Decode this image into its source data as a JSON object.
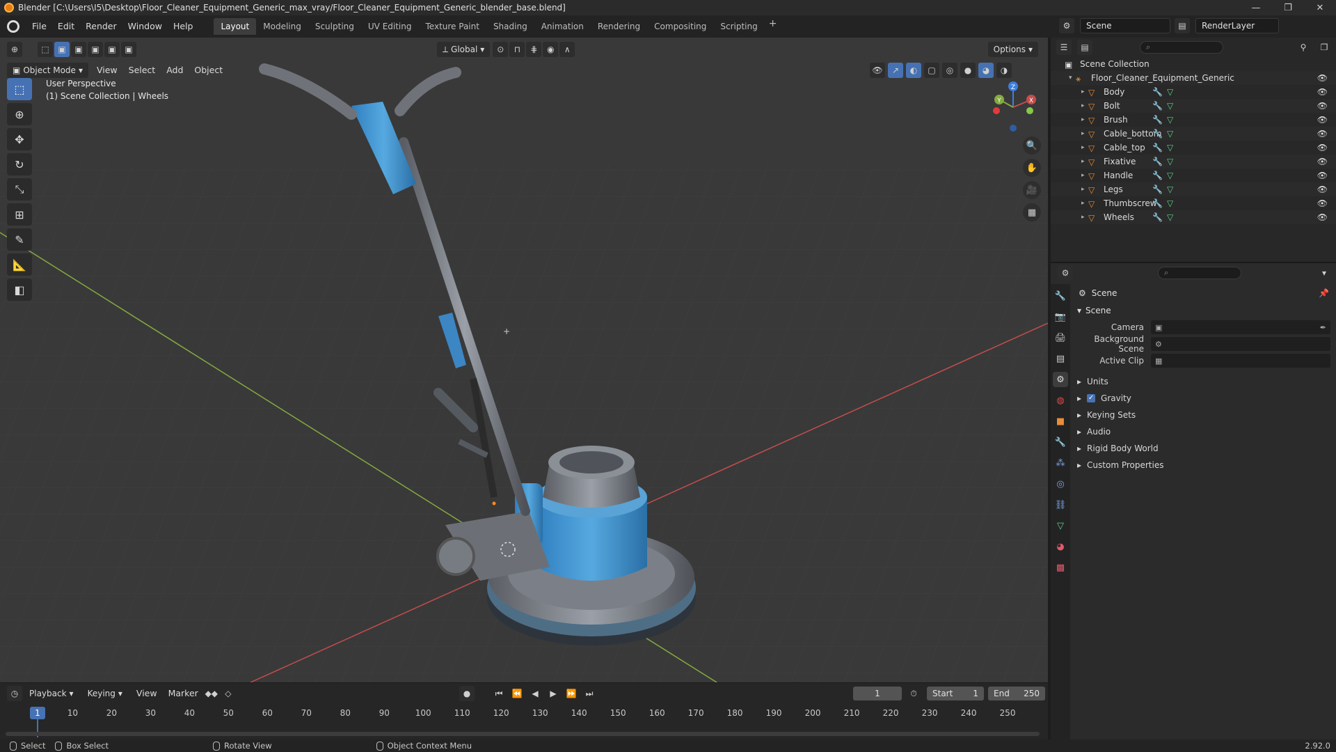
{
  "window": {
    "title": "Blender [C:\\Users\\I5\\Desktop\\Floor_Cleaner_Equipment_Generic_max_vray/Floor_Cleaner_Equipment_Generic_blender_base.blend]",
    "controls": [
      "—",
      "❐",
      "✕"
    ]
  },
  "menu": {
    "items": [
      "File",
      "Edit",
      "Render",
      "Window",
      "Help"
    ]
  },
  "workspaces": {
    "tabs": [
      "Layout",
      "Modeling",
      "Sculpting",
      "UV Editing",
      "Texture Paint",
      "Shading",
      "Animation",
      "Rendering",
      "Compositing",
      "Scripting"
    ],
    "active": "Layout",
    "add": "+"
  },
  "scene_selector": {
    "scene": "Scene",
    "view_layer": "RenderLayer"
  },
  "viewport": {
    "mode": "Object Mode",
    "menus": [
      "View",
      "Select",
      "Add",
      "Object"
    ],
    "transform_orientation": "Global",
    "options_label": "Options",
    "info_line1": "User Perspective",
    "info_line2": "(1) Scene Collection | Wheels",
    "gizmo_axes": {
      "x": "X",
      "y": "Y",
      "z": "Z"
    },
    "colors": {
      "background": "#393939",
      "x_axis": "#c54d4d",
      "y_axis": "#84ab3f",
      "z_axis": "#3b7fe0",
      "accent": "#4672b4"
    }
  },
  "timeline": {
    "menus": [
      "Playback",
      "Keying",
      "View",
      "Marker"
    ],
    "current_frame": "1",
    "start_label": "Start",
    "start_value": "1",
    "end_label": "End",
    "end_value": "250",
    "ticks": [
      "1",
      "10",
      "20",
      "30",
      "40",
      "50",
      "60",
      "70",
      "80",
      "90",
      "100",
      "110",
      "120",
      "130",
      "140",
      "150",
      "160",
      "170",
      "180",
      "190",
      "200",
      "210",
      "220",
      "230",
      "240",
      "250"
    ]
  },
  "statusbar": {
    "select": "Select",
    "box_select": "Box Select",
    "rotate_view": "Rotate View",
    "context_menu": "Object Context Menu",
    "version": "2.92.0"
  },
  "outliner": {
    "root": "Scene Collection",
    "collection": "Floor_Cleaner_Equipment_Generic",
    "objects": [
      "Body",
      "Bolt",
      "Brush",
      "Cable_bottom",
      "Cable_top",
      "Fixative",
      "Handle",
      "Legs",
      "Thumbscrew",
      "Wheels"
    ]
  },
  "properties": {
    "context": "Scene",
    "panel": "Scene",
    "camera_label": "Camera",
    "background_scene_label": "Background Scene",
    "active_clip_label": "Active Clip",
    "sub_panels": [
      "Units",
      "Gravity",
      "Keying Sets",
      "Audio",
      "Rigid Body World",
      "Custom Properties"
    ],
    "gravity_checked": true
  }
}
